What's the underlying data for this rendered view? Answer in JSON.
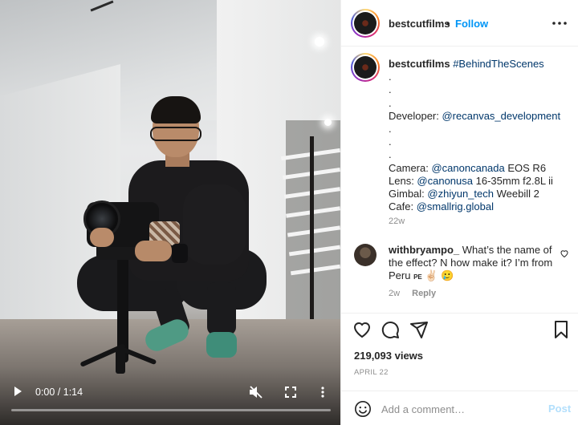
{
  "video": {
    "time_display": "0:00 / 1:14",
    "progress_fraction": 0.0,
    "muted": true
  },
  "header": {
    "username": "bestcutfilms",
    "separator": "•",
    "follow_label": "Follow"
  },
  "caption": {
    "username": "bestcutfilms",
    "hashtag": "#BehindTheScenes",
    "lines": [
      ".",
      ".",
      "."
    ],
    "developer_label": "Developer: ",
    "developer_handle": "@recanvas_development",
    "lines2": [
      ".",
      ".",
      "."
    ],
    "camera_label": "Camera: ",
    "camera_handle": "@canoncanada",
    "camera_model": " EOS R6",
    "lens_label": "Lens: ",
    "lens_handle": "@canonusa",
    "lens_model": " 16-35mm f2.8L ii",
    "gimbal_label": "Gimbal: ",
    "gimbal_handle": "@zhiyun_tech",
    "gimbal_model": " Weebill 2",
    "cafe_label": "Cafe: ",
    "cafe_handle": "@smallrig.global",
    "age": "22w"
  },
  "comment": {
    "username": "withbryampo_",
    "text": " What’s the name of the effect? N how make it? I’m from Peru ",
    "flag": "PE",
    "emojis": "✌🏻 🥲",
    "age": "2w",
    "reply_label": "Reply"
  },
  "stats": {
    "views": "219,093 views",
    "date": "APRIL 22"
  },
  "add_comment": {
    "placeholder": "Add a comment…",
    "post_label": "Post"
  },
  "colors": {
    "link": "#00376b",
    "follow": "#0095f6",
    "post_disabled": "#b2dffc",
    "muted_text": "#8e8e8e"
  },
  "icons": {
    "video": [
      "play-icon",
      "mute-icon",
      "fullscreen-icon",
      "more-vertical-icon"
    ],
    "header": [
      "more-horizontal-icon"
    ],
    "actions": [
      "heart-icon",
      "comment-icon",
      "share-icon",
      "bookmark-icon"
    ],
    "comment": [
      "heart-small-icon"
    ],
    "composer": [
      "emoji-icon"
    ]
  }
}
